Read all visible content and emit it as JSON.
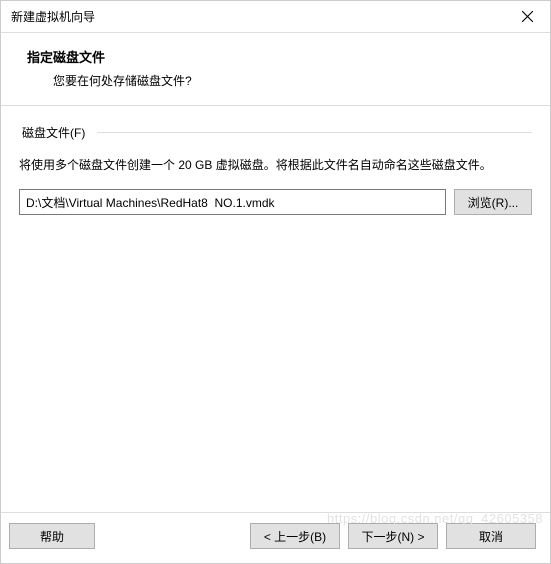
{
  "window": {
    "title": "新建虚拟机向导"
  },
  "header": {
    "title": "指定磁盘文件",
    "subtitle": "您要在何处存储磁盘文件?"
  },
  "group": {
    "label": "磁盘文件(F)",
    "description": "将使用多个磁盘文件创建一个 20 GB 虚拟磁盘。将根据此文件名自动命名这些磁盘文件。"
  },
  "path": {
    "value": "D:\\文档\\Virtual Machines\\RedHat8  NO.1.vmdk"
  },
  "buttons": {
    "browse": "浏览(R)...",
    "help": "帮助",
    "back": "< 上一步(B)",
    "next": "下一步(N) >",
    "cancel": "取消"
  },
  "watermark": "https://blog.csdn.net/qq_42605358"
}
